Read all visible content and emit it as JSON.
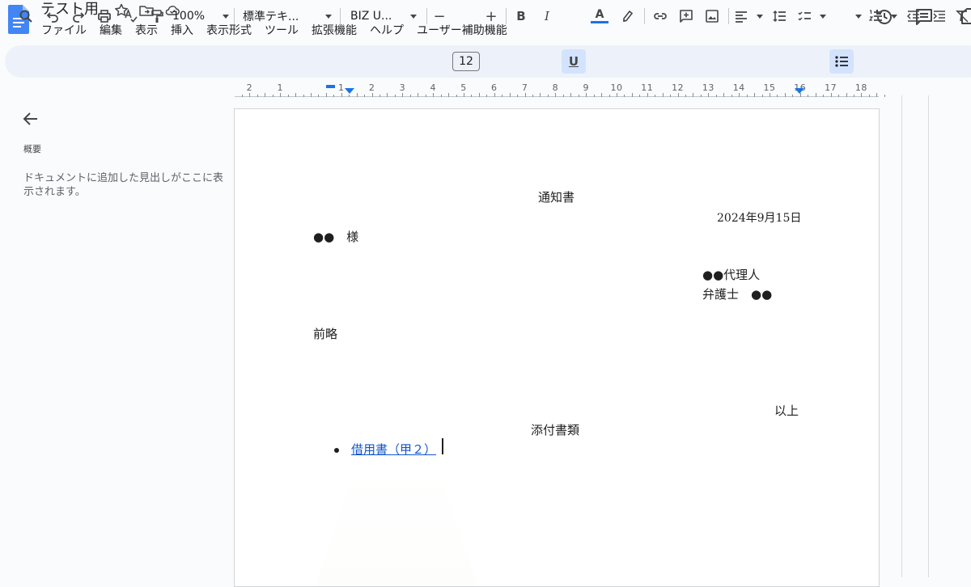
{
  "header": {
    "doc_title": "テスト用",
    "menus": [
      "ファイル",
      "編集",
      "表示",
      "挿入",
      "表示形式",
      "ツール",
      "拡張機能",
      "ヘルプ",
      "ユーザー補助機能"
    ]
  },
  "toolbar": {
    "zoom": "100%",
    "style": "標準テキ...",
    "font": "BIZ U...",
    "font_size": "12",
    "minus": "−",
    "plus": "+",
    "bold": "B",
    "italic": "I",
    "underline": "U",
    "text_color_letter": "A",
    "text_color": "#1a73e8"
  },
  "ruler": {
    "labels": [
      "2",
      "1",
      "1",
      "2",
      "3",
      "4",
      "5",
      "6",
      "7",
      "8",
      "9",
      "10",
      "11",
      "12",
      "13",
      "14",
      "15",
      "16",
      "17",
      "18"
    ]
  },
  "sidebar": {
    "heading": "概要",
    "hint": "ドキュメントに追加した見出しがここに表示されます。"
  },
  "document": {
    "title": "通知書",
    "date": "2024年9月15日",
    "addressee": "●●　様",
    "agent": "●●代理人",
    "lawyer": "弁護士　●●",
    "greeting": "前略",
    "closing": "以上",
    "attachments_heading": "添付書類",
    "attachment_item": "借用書（甲２）"
  },
  "colors": {
    "accent": "#1a73e8",
    "link": "#1155cc",
    "toolbar_bg": "#edf2fa",
    "page_bg": "#f9fbfd"
  }
}
